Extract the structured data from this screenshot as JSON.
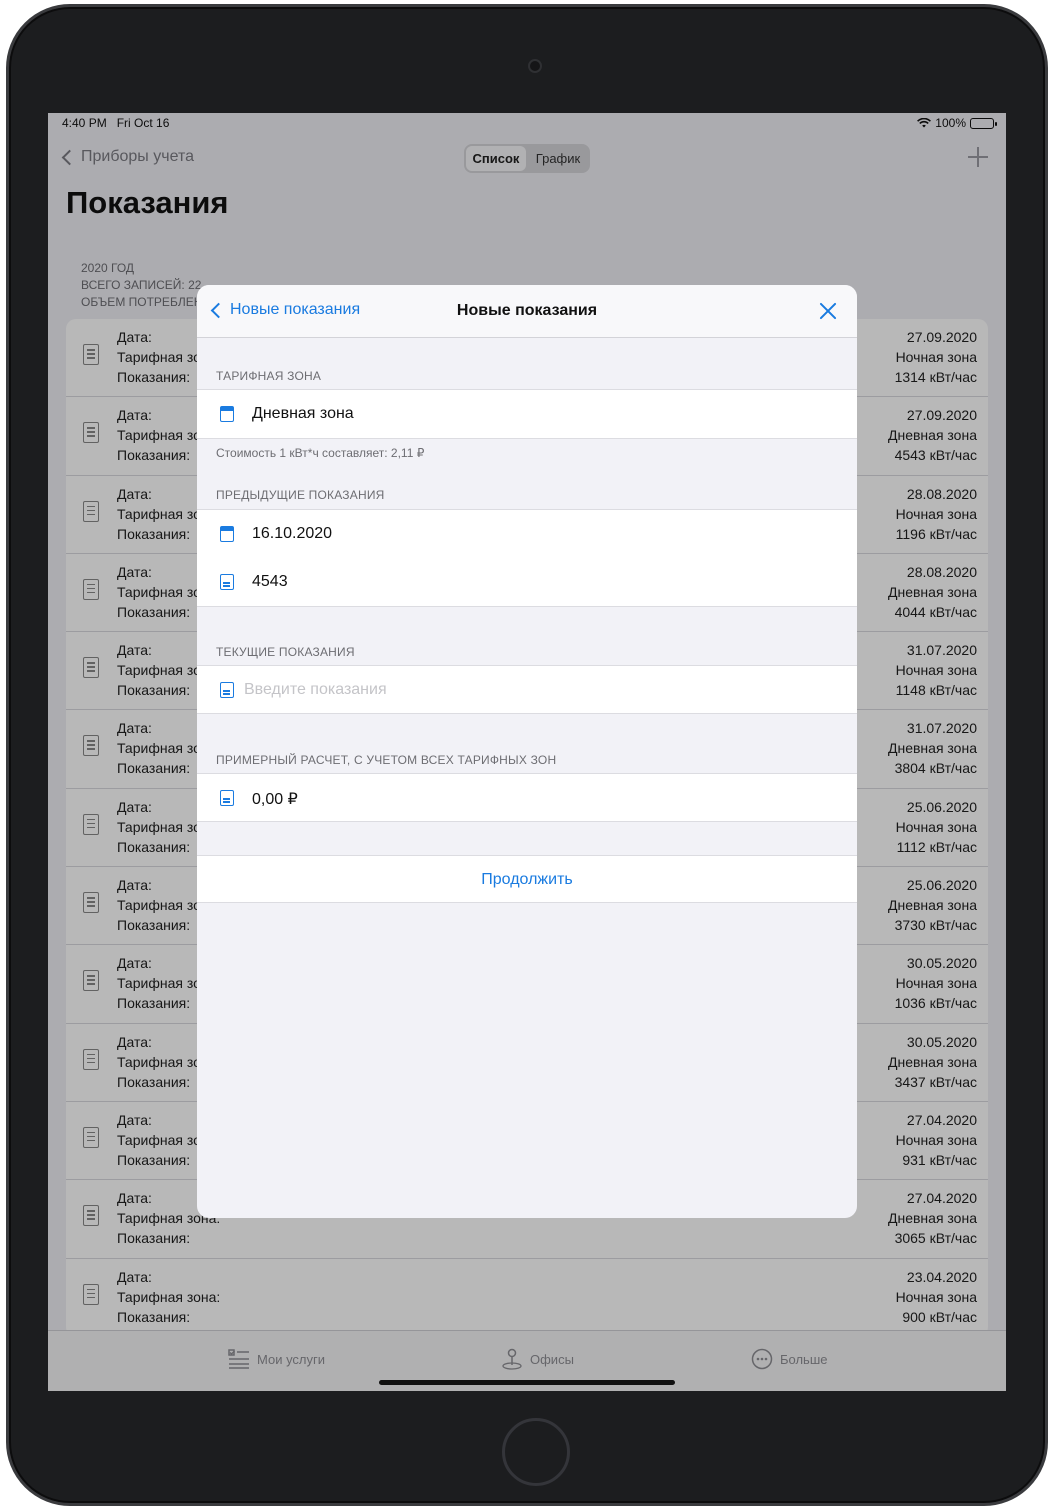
{
  "status_bar": {
    "time": "4:40 PM",
    "date": "Fri Oct 16",
    "battery": "100%"
  },
  "nav": {
    "back_label": "Приборы учета",
    "segments": [
      "Список",
      "График"
    ],
    "active_segment": "Список"
  },
  "page_title": "Показания",
  "summary": {
    "year": "2020 ГОД",
    "total": "ВСЕГО ЗАПИСЕЙ: 22",
    "volume": "ОБЪЕМ ПОТРЕБЛЕН"
  },
  "record_labels": {
    "date": "Дата:",
    "zone": "Тарифная зона:",
    "reading": "Показания:"
  },
  "records": [
    {
      "date": "27.09.2020",
      "zone": "Ночная зона",
      "value": "1314 кВт/час"
    },
    {
      "date": "27.09.2020",
      "zone": "Дневная зона",
      "value": "4543 кВт/час"
    },
    {
      "date": "28.08.2020",
      "zone": "Ночная зона",
      "value": "1196 кВт/час"
    },
    {
      "date": "28.08.2020",
      "zone": "Дневная зона",
      "value": "4044 кВт/час"
    },
    {
      "date": "31.07.2020",
      "zone": "Ночная зона",
      "value": "1148 кВт/час"
    },
    {
      "date": "31.07.2020",
      "zone": "Дневная зона",
      "value": "3804 кВт/час"
    },
    {
      "date": "25.06.2020",
      "zone": "Ночная зона",
      "value": "1112 кВт/час"
    },
    {
      "date": "25.06.2020",
      "zone": "Дневная зона",
      "value": "3730 кВт/час"
    },
    {
      "date": "30.05.2020",
      "zone": "Ночная зона",
      "value": "1036 кВт/час"
    },
    {
      "date": "30.05.2020",
      "zone": "Дневная зона",
      "value": "3437 кВт/час"
    },
    {
      "date": "27.04.2020",
      "zone": "Ночная зона",
      "value": "931 кВт/час"
    },
    {
      "date": "27.04.2020",
      "zone": "Дневная зона",
      "value": "3065 кВт/час"
    },
    {
      "date": "23.04.2020",
      "zone": "Ночная зона",
      "value": "900 кВт/час"
    }
  ],
  "tabs": [
    {
      "label": "Мои услуги",
      "icon": "services-icon"
    },
    {
      "label": "Офисы",
      "icon": "map-pin-icon"
    },
    {
      "label": "Больше",
      "icon": "more-icon"
    }
  ],
  "modal": {
    "back_label": "Новые показания",
    "title": "Новые показания",
    "tariff": {
      "header": "ТАРИФНАЯ ЗОНА",
      "value": "Дневная зона",
      "note": "Стоимость 1 кВт*ч составляет: 2,11 ₽"
    },
    "previous": {
      "header": "ПРЕДЫДУЩИЕ ПОКАЗАНИЯ",
      "date": "16.10.2020",
      "value": "4543"
    },
    "current": {
      "header": "ТЕКУЩИЕ ПОКАЗАНИЯ",
      "placeholder": "Введите показания",
      "value": ""
    },
    "estimate": {
      "header": "ПРИМЕРНЫЙ РАСЧЕТ, С УЧЕТОМ ВСЕХ ТАРИФНЫХ ЗОН",
      "value": "0,00 ₽"
    },
    "continue_label": "Продолжить"
  },
  "colors": {
    "accent": "#1a7be0",
    "background": "#efeff4",
    "modal_background": "#f2f2f7"
  }
}
